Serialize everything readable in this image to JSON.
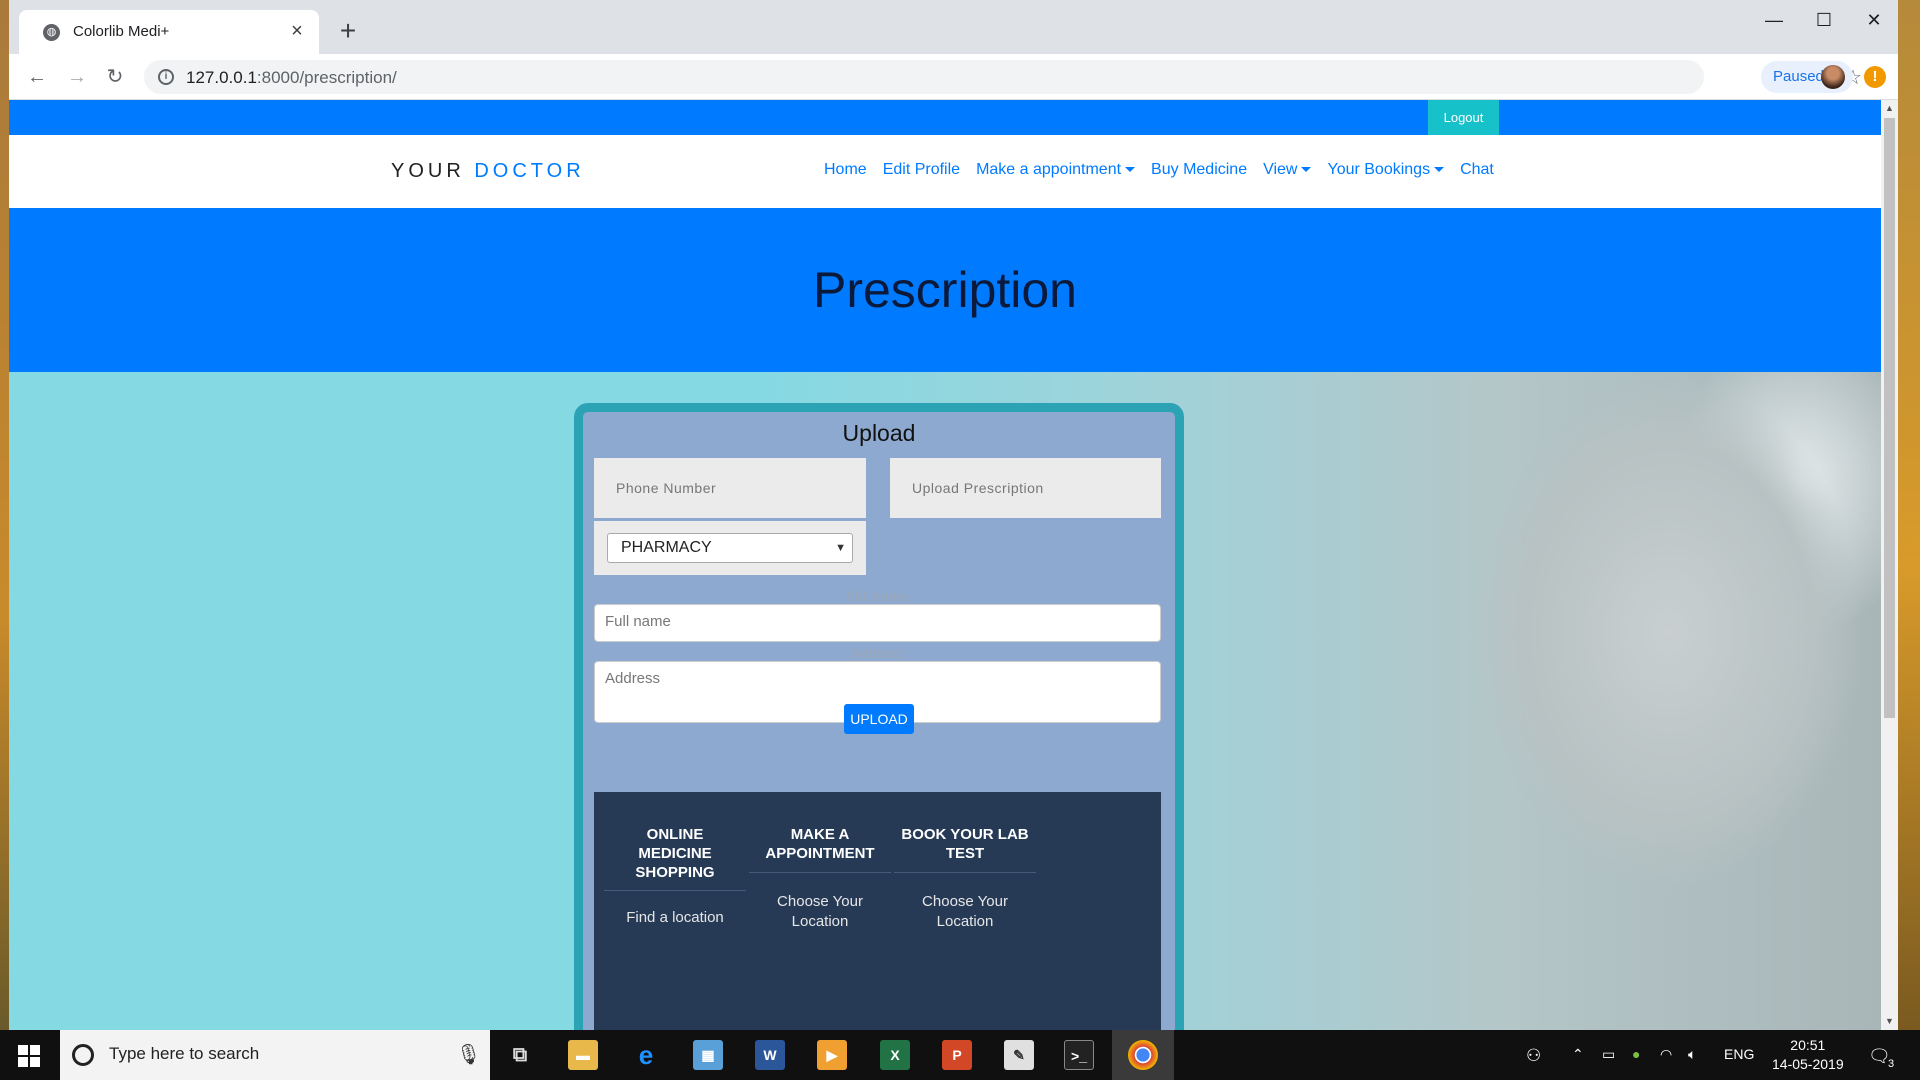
{
  "browser": {
    "tab_title": "Colorlib Medi+",
    "url_host": "127.0.0.1",
    "url_rest": ":8000/prescription/",
    "profile_status": "Paused",
    "alert_symbol": "!"
  },
  "site": {
    "logout": "Logout",
    "brand_part1": "YOUR",
    "brand_part2": "DOCTOR",
    "nav": [
      {
        "label": "Home",
        "dropdown": false
      },
      {
        "label": "Edit Profile",
        "dropdown": false
      },
      {
        "label": "Make a appointment",
        "dropdown": true
      },
      {
        "label": "Buy Medicine",
        "dropdown": false
      },
      {
        "label": "View",
        "dropdown": true
      },
      {
        "label": "Your Bookings",
        "dropdown": true
      },
      {
        "label": "Chat",
        "dropdown": false
      }
    ],
    "hero_title": "Prescription"
  },
  "form": {
    "title": "Upload",
    "phone_placeholder": "Phone Number",
    "prescription_placeholder": "Upload Prescription",
    "pharmacy_selected": "PHARMACY",
    "fullname_label": "Full name:",
    "fullname_placeholder": "Full name",
    "address_label": "Address:",
    "address_placeholder": "Address",
    "submit": "UPLOAD"
  },
  "footer": {
    "col1_head_1": "ONLINE",
    "col1_head_2": "MEDICINE",
    "col1_head_3": "SHOPPING",
    "col1_sub": "Find a location",
    "col2_head_1": "MAKE A",
    "col2_head_2": "APPOINTMENT",
    "col2_sub_1": "Choose Your",
    "col2_sub_2": "Location",
    "col3_head_1": "BOOK YOUR LAB",
    "col3_head_2": "TEST",
    "col3_sub_1": "Choose Your",
    "col3_sub_2": "Location"
  },
  "taskbar": {
    "search_placeholder": "Type here to search",
    "language": "ENG",
    "time": "20:51",
    "date": "14-05-2019",
    "notification_count": "3"
  },
  "colors": {
    "primary": "#007bff",
    "logout": "#17c1c9",
    "card_border": "#2ba3b5",
    "card_bg": "#8ea9d0",
    "footer_bg": "#263a56"
  }
}
